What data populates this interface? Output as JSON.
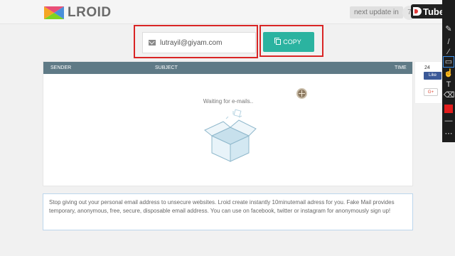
{
  "header": {
    "logo_text": "LROID",
    "next_update_label": "next update in",
    "timer_value": "7"
  },
  "dtube": {
    "label": "Tube"
  },
  "mailbox": {
    "email": "lutrayil@giyam.com",
    "copy_label": "COPY"
  },
  "inbox": {
    "columns": [
      "SENDER",
      "SUBJECT",
      "TIME"
    ],
    "waiting_text": "Waiting for e-mails.."
  },
  "social": {
    "fb_count": "24",
    "fb_like_label": "Like",
    "gplus_label": "G+"
  },
  "info_text": "Stop giving out your personal email address to unsecure websites. Lroid create instantly 10minutemail adress for you. Fake Mail provides temporary, anonymous, free, secure, disposable email address. You can use on facebook, twitter or instagram for anonymously sign up!",
  "colors": {
    "accent": "#2bb3a0",
    "header_bar": "#5f7a86",
    "highlight": "#d92525"
  },
  "icons": {
    "email": "envelope-icon",
    "copy": "copy-icon",
    "empty_inbox": "open-box-icon"
  }
}
